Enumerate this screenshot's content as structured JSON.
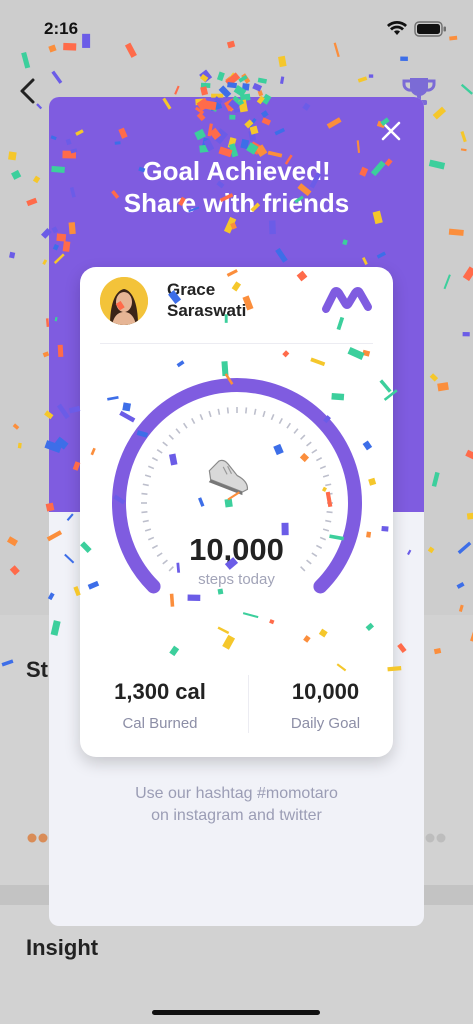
{
  "status_bar": {
    "time": "2:16"
  },
  "background": {
    "section_label": "St",
    "insight_label": "Insight"
  },
  "modal": {
    "title_line1": "Goal Achieved!",
    "title_line2": "Share with friends",
    "hashtag_line1": "Use our hashtag #momotaro",
    "hashtag_line2": "on instagram and twitter",
    "accent_color": "#7f5ce0"
  },
  "card": {
    "user_first_name": "Grace",
    "user_last_name": "Saraswati",
    "steps_value": "10,000",
    "steps_label": "steps today",
    "calories_value": "1,300 cal",
    "calories_label": "Cal Burned",
    "goal_value": "10,000",
    "goal_label": "Daily Goal",
    "progress_fraction": 1.0
  },
  "icons": [
    "back-arrow-icon",
    "trophy-icon",
    "close-icon",
    "sneaker-icon",
    "app-logo-icon",
    "wifi-icon",
    "battery-icon",
    "signal-icon"
  ]
}
